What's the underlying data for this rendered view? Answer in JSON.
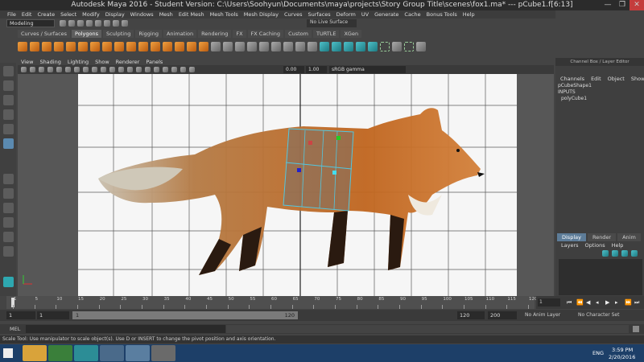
{
  "window": {
    "title": "Autodesk Maya 2016 - Student Version: C:\\Users\\Soohyun\\Documents\\maya\\projects\\Story Group Title\\scenes\\fox1.ma* --- pCube1.f[6:13]",
    "minimize": "—",
    "maximize": "❐",
    "close": "✕"
  },
  "menubar": [
    "File",
    "Edit",
    "Create",
    "Select",
    "Modify",
    "Display",
    "Windows",
    "Mesh",
    "Edit Mesh",
    "Mesh Tools",
    "Mesh Display",
    "Curves",
    "Surfaces",
    "Deform",
    "UV",
    "Generate",
    "Cache",
    "Bonus Tools",
    "Help"
  ],
  "statusline": {
    "mode": "Modeling",
    "live_surface": "No Live Surface"
  },
  "shelf_tabs": [
    "Curves / Surfaces",
    "Polygons",
    "Sculpting",
    "Rigging",
    "Animation",
    "Rendering",
    "FX",
    "FX Caching",
    "Custom",
    "TURTLE",
    "XGen"
  ],
  "shelf_active": "Polygons",
  "panel_menu": [
    "View",
    "Shading",
    "Lighting",
    "Show",
    "Renderer",
    "Panels"
  ],
  "panel_toolbar": {
    "field1": "0.00",
    "field2": "1.00",
    "color_space": "sRGB gamma"
  },
  "channel_box": {
    "header": "Channel Box / Layer Editor",
    "menu": [
      "Channels",
      "Edit",
      "Object",
      "Show"
    ],
    "shape": "pCubeShape1",
    "inputs_label": "INPUTS",
    "input_node": "polyCube1"
  },
  "layer_editor": {
    "tabs": [
      "Display",
      "Render",
      "Anim"
    ],
    "active_tab": "Display",
    "menu": [
      "Layers",
      "Options",
      "Help"
    ]
  },
  "timeline": {
    "ticks": [
      "1",
      "5",
      "10",
      "15",
      "20",
      "25",
      "30",
      "35",
      "40",
      "45",
      "50",
      "55",
      "60",
      "65",
      "70",
      "75",
      "80",
      "85",
      "90",
      "95",
      "100",
      "105",
      "110",
      "115",
      "120"
    ],
    "current_frame": "1"
  },
  "range": {
    "start": "1",
    "start_inner": "1",
    "bar_start": "1",
    "bar_end": "120",
    "end_inner": "120",
    "end": "200",
    "anim_layer": "No Anim Layer",
    "character_set": "No Character Set"
  },
  "mel": {
    "label": "MEL"
  },
  "helpline": "Scale Tool: Use manipulator to scale object(s). Use D or INSERT to change the pivot position and axis orientation.",
  "taskbar": {
    "language": "ENG",
    "time": "3:59 PM",
    "date": "2/20/2016"
  }
}
